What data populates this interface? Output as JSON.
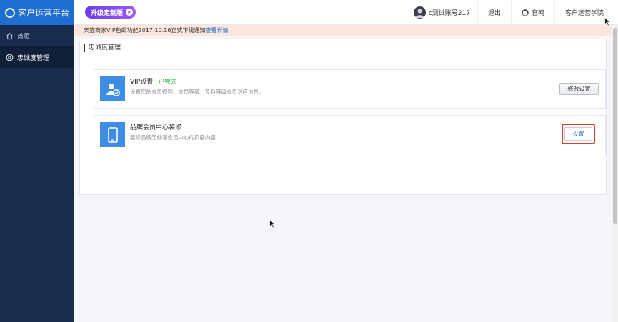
{
  "sidebar": {
    "logo_text": "客户运营平台",
    "items": [
      {
        "label": "首页",
        "icon": "home-icon"
      },
      {
        "label": "忠诚度管理",
        "icon": "loyalty-icon"
      }
    ]
  },
  "topbar": {
    "upgrade_label": "升级定制版",
    "account_name": "c测试账号217",
    "logout_label": "退出",
    "site_label": "官网",
    "academy_label": "客户运营学院"
  },
  "notice": {
    "text": "天猫商家VIP包邮功能2017.10.16正式下线通知",
    "link": "查看详情"
  },
  "main": {
    "section_title": "忠诚度管理",
    "cards": [
      {
        "title": "VIP设置",
        "status": "已完成",
        "desc": "设置您的会员规则、会员等级，及各等级会员对应信息。",
        "button": "修改设置"
      },
      {
        "title": "品牌会员中心装修",
        "desc": "装修品牌无线端会员中心的页面内容",
        "button": "设置"
      }
    ]
  },
  "colors": {
    "sidebar_bg": "#1a2c4e",
    "logo_bg": "#1e6fd1",
    "accent_blue": "#3f8ce4",
    "status_green": "#2eb52e",
    "highlight_red": "#d9442f",
    "notice_bg": "#fde6db"
  }
}
